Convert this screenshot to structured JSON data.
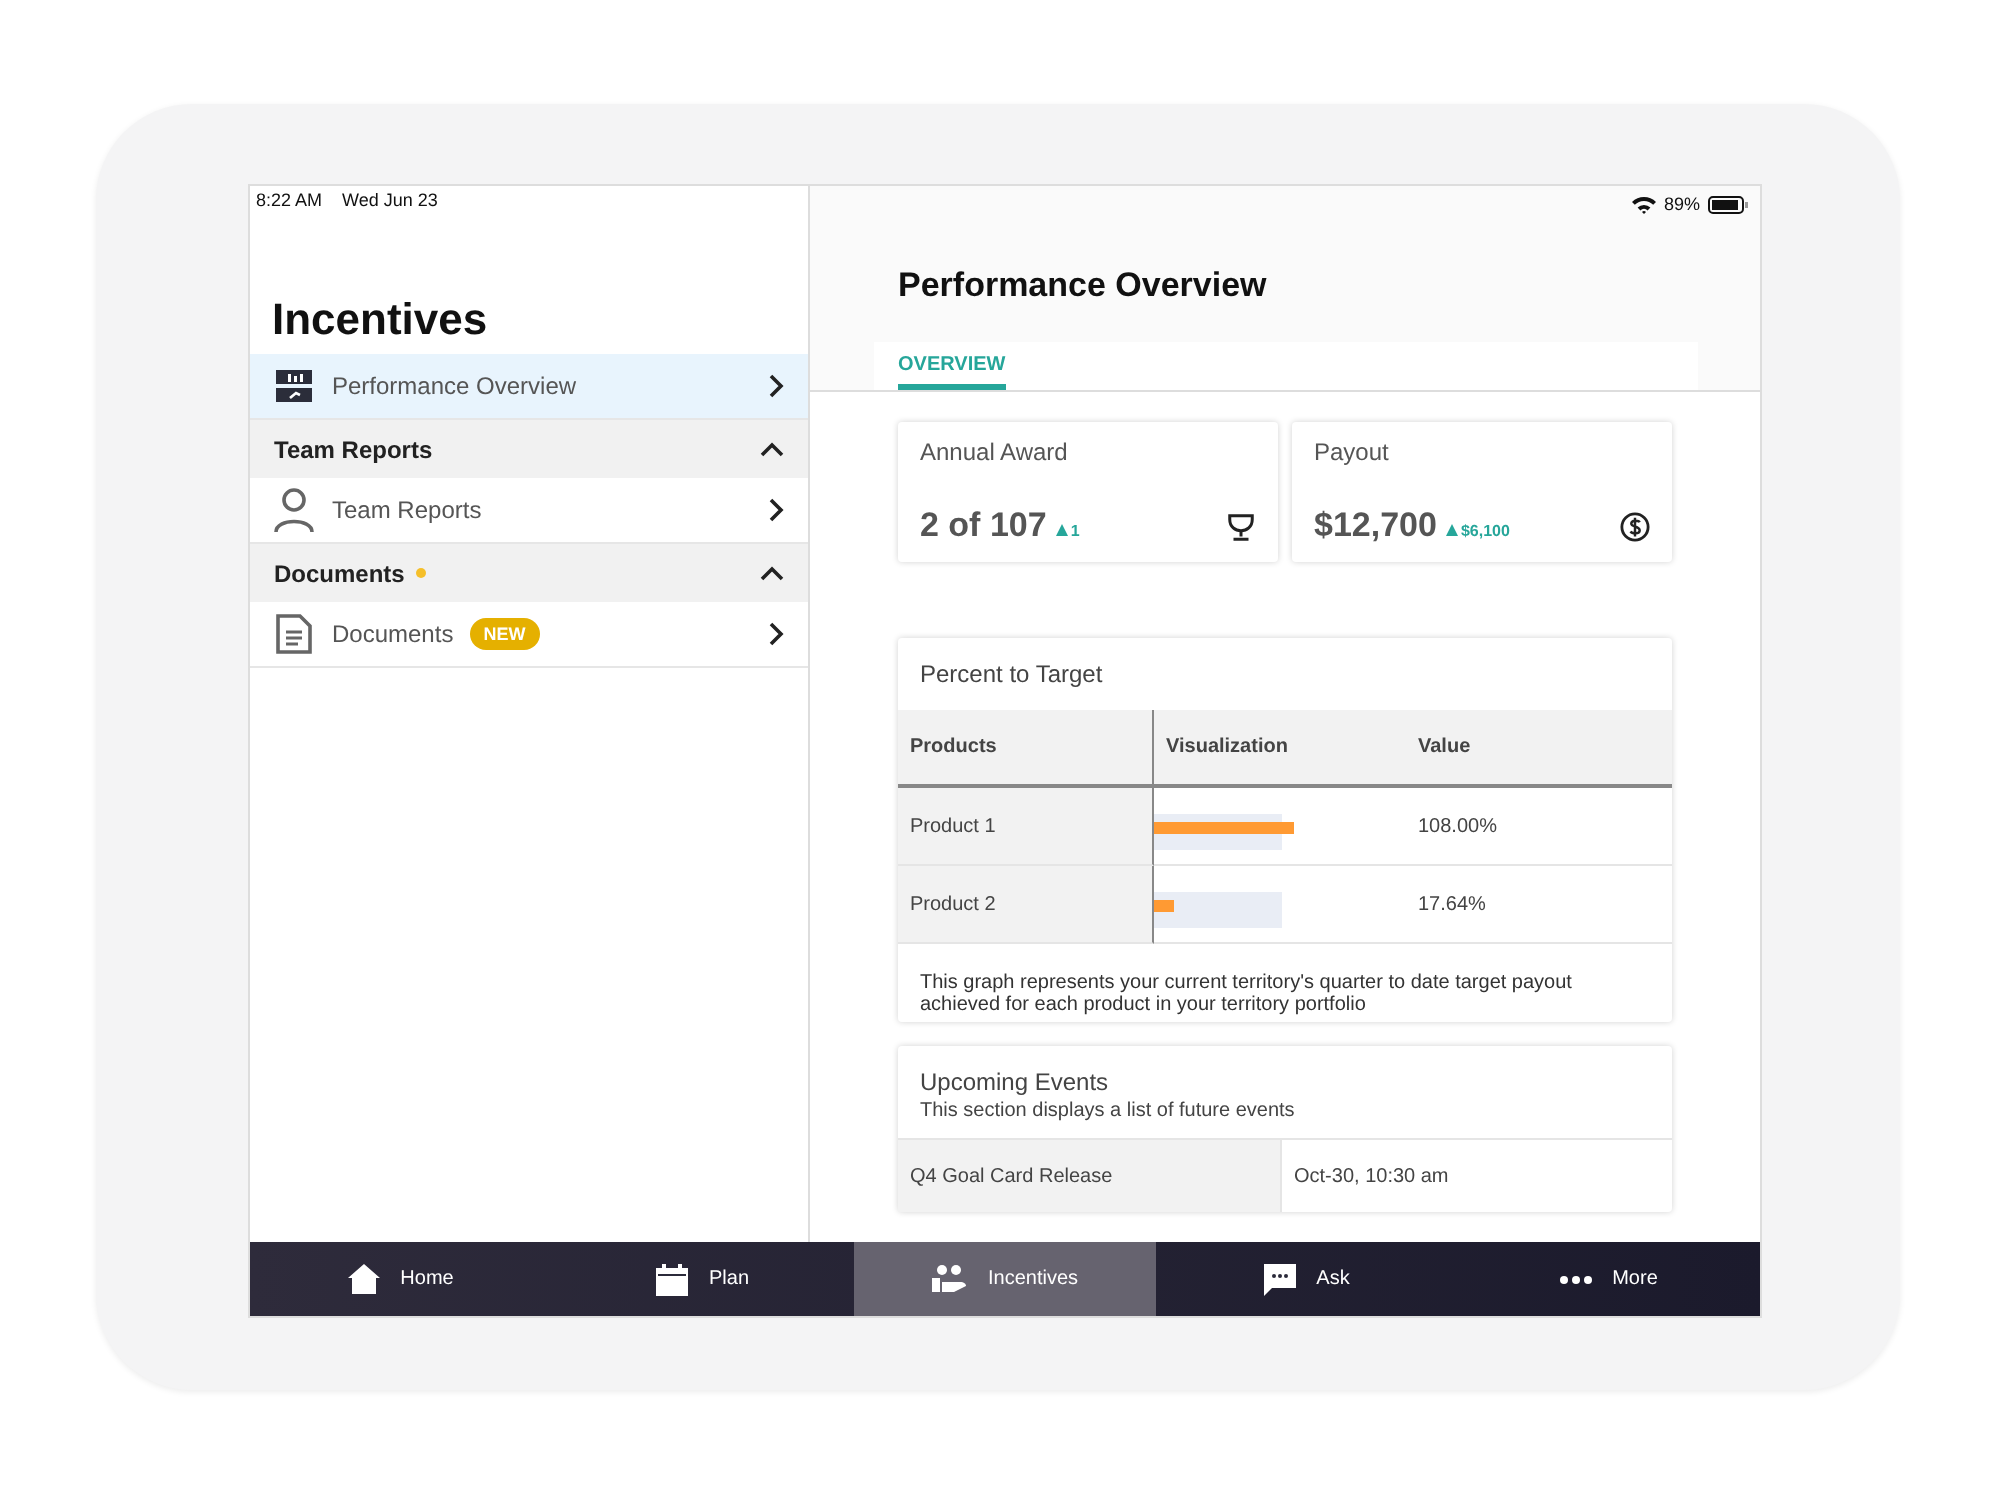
{
  "status_bar": {
    "time": "8:22 AM",
    "date": "Wed Jun 23",
    "battery": "89%"
  },
  "sidebar": {
    "title": "Incentives",
    "items": [
      {
        "kind": "link",
        "label": "Performance Overview",
        "selected": true
      },
      {
        "kind": "header",
        "label": "Team Reports",
        "expanded": true,
        "dot": false
      },
      {
        "kind": "link",
        "label": "Team Reports",
        "selected": false
      },
      {
        "kind": "header",
        "label": "Documents",
        "expanded": true,
        "dot": true
      },
      {
        "kind": "link",
        "label": "Documents",
        "badge": "NEW",
        "selected": false
      }
    ]
  },
  "main": {
    "title": "Performance Overview",
    "tabs": [
      {
        "label": "OVERVIEW",
        "selected": true
      }
    ],
    "kpis": [
      {
        "label": "Annual Award",
        "value": "2 of 107",
        "change": "1"
      },
      {
        "label": "Payout",
        "value": "$12,700",
        "change": "$6,100"
      }
    ],
    "target": {
      "title": "Percent to Target",
      "columns": [
        "Products",
        "Visualization",
        "Value"
      ],
      "rows": [
        {
          "product": "Product 1",
          "level": 0.64,
          "value": "108.00%"
        },
        {
          "product": "Product 2",
          "level": 0.09,
          "value": "17.64%"
        }
      ],
      "note": "This graph represents your current territory's quarter to date target payout achieved for each product in your territory portfolio"
    },
    "events": {
      "title": "Upcoming Events",
      "subtitle": "This section displays a list of future events",
      "rows": [
        {
          "name": "Q4 Goal Card Release",
          "time": "Oct-30, 10:30 am"
        }
      ]
    }
  },
  "tab_bar": [
    {
      "label": "Home",
      "selected": false
    },
    {
      "label": "Plan",
      "selected": false
    },
    {
      "label": "Incentives",
      "selected": true
    },
    {
      "label": "Ask",
      "selected": false
    },
    {
      "label": "More",
      "selected": false
    }
  ]
}
